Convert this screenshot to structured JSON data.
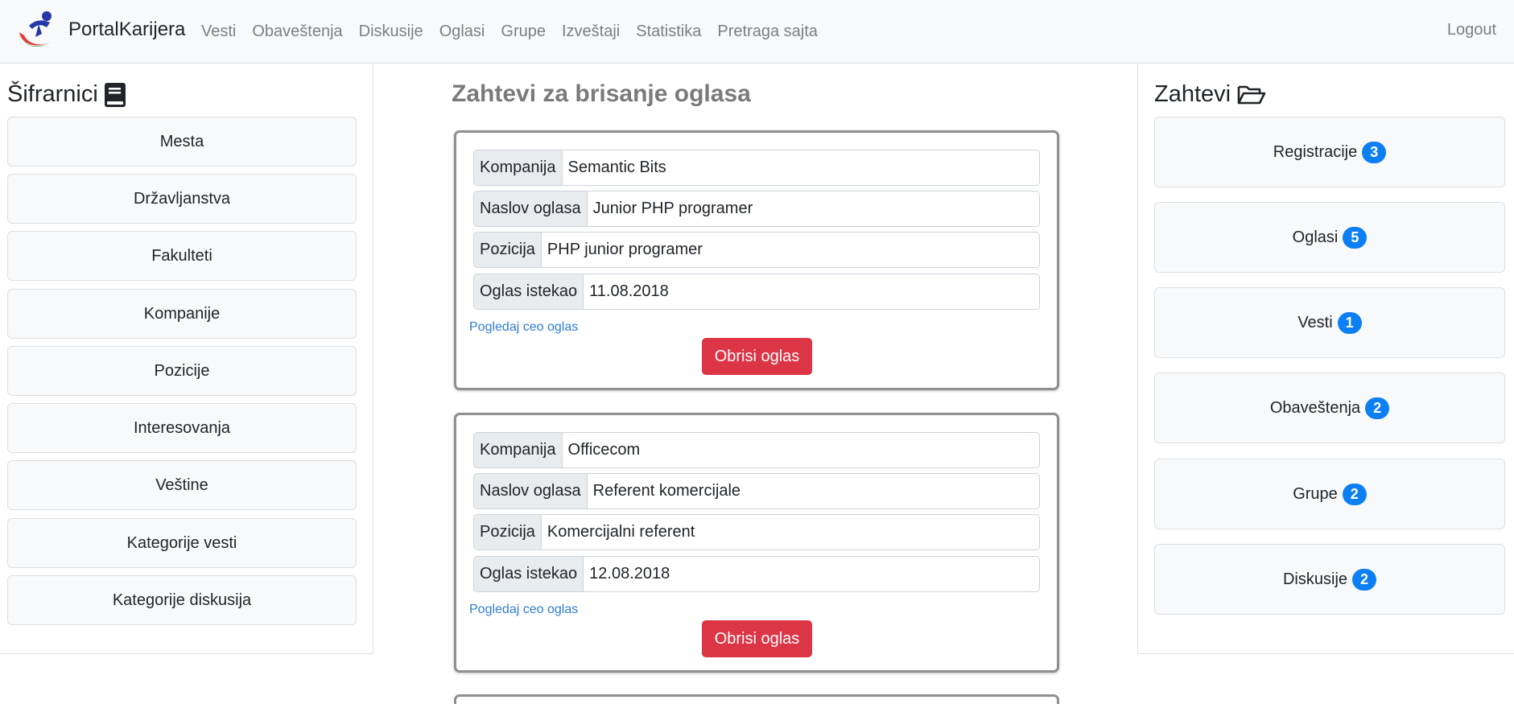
{
  "navbar": {
    "brand": "PortalKarijera",
    "links": [
      "Vesti",
      "Obaveštenja",
      "Diskusije",
      "Oglasi",
      "Grupe",
      "Izveštaji",
      "Statistika",
      "Pretraga sajta"
    ],
    "logout": "Logout"
  },
  "left": {
    "title": "Šifrarnici",
    "icon": "book-icon",
    "items": [
      "Mesta",
      "Državljanstva",
      "Fakulteti",
      "Kompanije",
      "Pozicije",
      "Interesovanja",
      "Veštine",
      "Kategorije vesti",
      "Kategorije diskusija"
    ]
  },
  "center": {
    "title": "Zahtevi za brisanje oglasa",
    "cards": [
      {
        "fields": [
          {
            "label": "Kompanija",
            "value": "Semantic Bits"
          },
          {
            "label": "Naslov oglasa",
            "value": "Junior PHP programer"
          },
          {
            "label": "Pozicija",
            "value": "PHP junior programer"
          },
          {
            "label": "Oglas istekao",
            "value": "11.08.2018"
          }
        ],
        "link": "Pogledaj ceo oglas",
        "button": "Obrisi oglas"
      },
      {
        "fields": [
          {
            "label": "Kompanija",
            "value": "Officecom"
          },
          {
            "label": "Naslov oglasa",
            "value": "Referent komercijale"
          },
          {
            "label": "Pozicija",
            "value": "Komercijalni referent"
          },
          {
            "label": "Oglas istekao",
            "value": "12.08.2018"
          }
        ],
        "link": "Pogledaj ceo oglas",
        "button": "Obrisi oglas"
      }
    ]
  },
  "right": {
    "title": "Zahtevi",
    "icon": "folder-open-icon",
    "items": [
      {
        "label": "Registracije",
        "count": "3"
      },
      {
        "label": "Oglasi",
        "count": "5"
      },
      {
        "label": "Vesti",
        "count": "1"
      },
      {
        "label": "Obaveštenja",
        "count": "2"
      },
      {
        "label": "Grupe",
        "count": "2"
      },
      {
        "label": "Diskusije",
        "count": "2"
      }
    ]
  },
  "colors": {
    "danger": "#dc3545",
    "badge": "#0d7ff5",
    "link": "#2d7dd2",
    "navbar_bg": "#f8f9fa"
  }
}
